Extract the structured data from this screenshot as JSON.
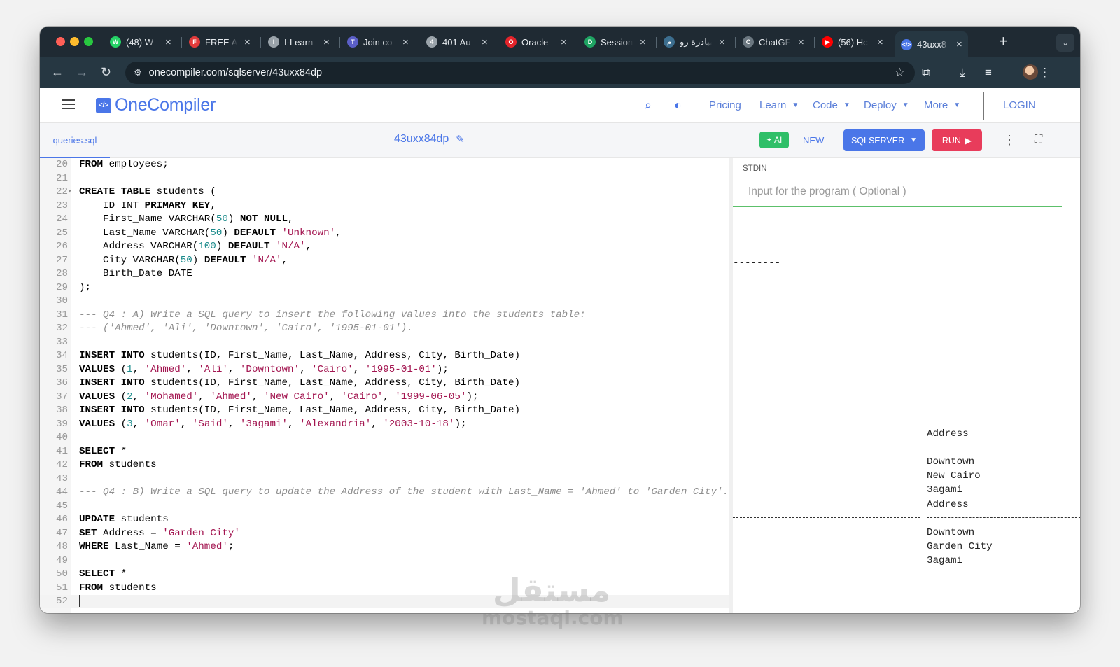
{
  "browser": {
    "tabs": [
      {
        "label": "(48) W",
        "fav_color": "#25d366",
        "fav": "W"
      },
      {
        "label": "FREE A",
        "fav_color": "#e23b3b",
        "fav": "F"
      },
      {
        "label": "I-Learn",
        "fav_color": "#9aa3aa",
        "fav": "I"
      },
      {
        "label": "Join co",
        "fav_color": "#5b5fc7",
        "fav": "T"
      },
      {
        "label": "401 Au",
        "fav_color": "#9aa3aa",
        "fav": "4"
      },
      {
        "label": "Oracle",
        "fav_color": "#e3242b",
        "fav": "O"
      },
      {
        "label": "Session",
        "fav_color": "#1fa463",
        "fav": "D"
      },
      {
        "label": "مبادرة رو",
        "fav_color": "#3c6e8f",
        "fav": "م"
      },
      {
        "label": "ChatGF",
        "fav_color": "#6b7780",
        "fav": "C"
      },
      {
        "label": "(56) Hc",
        "fav_color": "#ff0000",
        "fav": "▶"
      },
      {
        "label": "43uxx8",
        "fav_color": "#4a76e8",
        "fav": "</>"
      }
    ],
    "url": "onecompiler.com/sqlserver/43uxx84dp"
  },
  "site": {
    "logo_text": "OneCompiler",
    "nav": {
      "pricing": "Pricing",
      "learn": "Learn",
      "code": "Code",
      "deploy": "Deploy",
      "more": "More",
      "login": "LOGIN"
    }
  },
  "editor_toolbar": {
    "file_tab": "queries.sql",
    "code_id": "43uxx84dp",
    "ai_label": "AI",
    "new_label": "NEW",
    "language": "SQLSERVER",
    "run_label": "RUN"
  },
  "code_lines": [
    {
      "n": "20",
      "html": "<span class=\"kw\">FROM</span> employees;"
    },
    {
      "n": "21",
      "html": ""
    },
    {
      "n": "22",
      "html": "<span class=\"kw\">CREATE TABLE</span> students (",
      "fold": true
    },
    {
      "n": "23",
      "html": "    ID INT <span class=\"kw\">PRIMARY KEY</span>,"
    },
    {
      "n": "24",
      "html": "    First_Name VARCHAR(<span class=\"num\">50</span>) <span class=\"kw\">NOT NULL</span>,"
    },
    {
      "n": "25",
      "html": "    Last_Name VARCHAR(<span class=\"num\">50</span>) <span class=\"kw\">DEFAULT</span> <span class=\"str\">'Unknown'</span>,"
    },
    {
      "n": "26",
      "html": "    Address VARCHAR(<span class=\"num\">100</span>) <span class=\"kw\">DEFAULT</span> <span class=\"str\">'N/A'</span>,"
    },
    {
      "n": "27",
      "html": "    City VARCHAR(<span class=\"num\">50</span>) <span class=\"kw\">DEFAULT</span> <span class=\"str\">'N/A'</span>,"
    },
    {
      "n": "28",
      "html": "    Birth_Date DATE"
    },
    {
      "n": "29",
      "html": ");"
    },
    {
      "n": "30",
      "html": ""
    },
    {
      "n": "31",
      "html": "<span class=\"cmt\">--- Q4 : A) Write a SQL query to insert the following values into the students table:</span>"
    },
    {
      "n": "32",
      "html": "<span class=\"cmt\">--- ('Ahmed', 'Ali', 'Downtown', 'Cairo', '1995-01-01').</span>"
    },
    {
      "n": "33",
      "html": ""
    },
    {
      "n": "34",
      "html": "<span class=\"kw\">INSERT INTO</span> students(ID, First_Name, Last_Name, Address, City, Birth_Date)"
    },
    {
      "n": "35",
      "html": "<span class=\"kw\">VALUES</span> (<span class=\"num\">1</span>, <span class=\"str\">'Ahmed'</span>, <span class=\"str\">'Ali'</span>, <span class=\"str\">'Downtown'</span>, <span class=\"str\">'Cairo'</span>, <span class=\"str\">'1995-01-01'</span>);"
    },
    {
      "n": "36",
      "html": "<span class=\"kw\">INSERT INTO</span> students(ID, First_Name, Last_Name, Address, City, Birth_Date)"
    },
    {
      "n": "37",
      "html": "<span class=\"kw\">VALUES</span> (<span class=\"num\">2</span>, <span class=\"str\">'Mohamed'</span>, <span class=\"str\">'Ahmed'</span>, <span class=\"str\">'New Cairo'</span>, <span class=\"str\">'Cairo'</span>, <span class=\"str\">'1999-06-05'</span>);"
    },
    {
      "n": "38",
      "html": "<span class=\"kw\">INSERT INTO</span> students(ID, First_Name, Last_Name, Address, City, Birth_Date)"
    },
    {
      "n": "39",
      "html": "<span class=\"kw\">VALUES</span> (<span class=\"num\">3</span>, <span class=\"str\">'Omar'</span>, <span class=\"str\">'Said'</span>, <span class=\"str\">'3agami'</span>, <span class=\"str\">'Alexandria'</span>, <span class=\"str\">'2003-10-18'</span>);"
    },
    {
      "n": "40",
      "html": ""
    },
    {
      "n": "41",
      "html": "<span class=\"kw\">SELECT</span> *"
    },
    {
      "n": "42",
      "html": "<span class=\"kw\">FROM</span> students"
    },
    {
      "n": "43",
      "html": ""
    },
    {
      "n": "44",
      "html": "<span class=\"cmt\">--- Q4 : B) Write a SQL query to update the Address of the student with Last_Name = 'Ahmed' to 'Garden City'.</span>"
    },
    {
      "n": "45",
      "html": ""
    },
    {
      "n": "46",
      "html": "<span class=\"kw\">UPDATE</span> students"
    },
    {
      "n": "47",
      "html": "<span class=\"kw\">SET</span> Address = <span class=\"str\">'Garden City'</span>"
    },
    {
      "n": "48",
      "html": "<span class=\"kw\">WHERE</span> Last_Name = <span class=\"str\">'Ahmed'</span>;"
    },
    {
      "n": "49",
      "html": ""
    },
    {
      "n": "50",
      "html": "<span class=\"kw\">SELECT</span> *"
    },
    {
      "n": "51",
      "html": "<span class=\"kw\">FROM</span> students"
    },
    {
      "n": "52",
      "html": "<span class=\"cursor\"></span>",
      "current": true
    }
  ],
  "stdin": {
    "label": "STDIN",
    "placeholder": "Input for the program ( Optional )"
  },
  "output": {
    "short_dashes": "--------",
    "header1": "Address",
    "rows1": [
      "Downtown",
      "New Cairo",
      "3agami"
    ],
    "header2": "Address",
    "rows2": [
      "Downtown",
      "Garden City",
      "3agami"
    ]
  },
  "watermark": {
    "arabic": "مستقل",
    "latin": "mostaql.com"
  }
}
